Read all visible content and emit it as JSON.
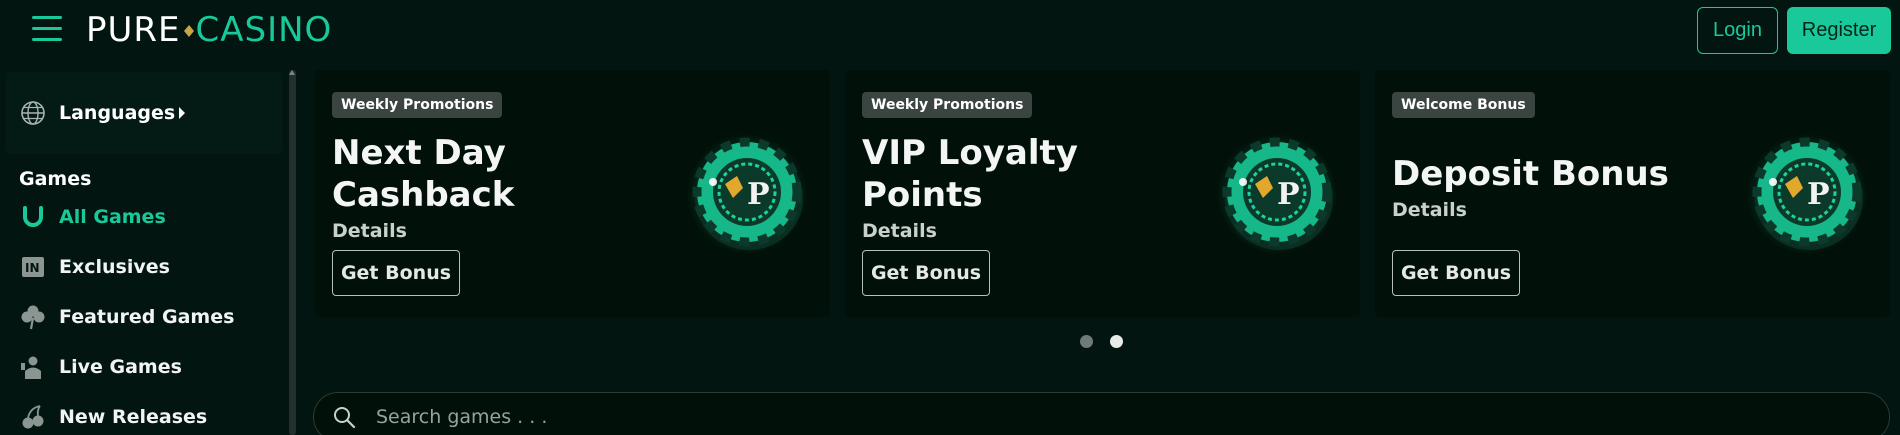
{
  "header": {
    "logo_left": "PURE",
    "logo_right": "CASINO",
    "login_label": "Login",
    "register_label": "Register"
  },
  "sidebar": {
    "languages_label": "Languages",
    "games_heading": "Games",
    "items": [
      {
        "label": "All Games",
        "icon": "horseshoe-icon",
        "active": true
      },
      {
        "label": "Exclusives",
        "icon": "exclusive-badge-icon",
        "active": false
      },
      {
        "label": "Featured Games",
        "icon": "clover-icon",
        "active": false
      },
      {
        "label": "Live Games",
        "icon": "live-dealer-icon",
        "active": false
      },
      {
        "label": "New Releases",
        "icon": "cherries-icon",
        "active": false
      }
    ]
  },
  "promos": [
    {
      "badge": "Weekly Promotions",
      "title_line1": "Next Day",
      "title_line2": "Cashback",
      "details": "Details",
      "button": "Get Bonus"
    },
    {
      "badge": "Weekly Promotions",
      "title_line1": "VIP Loyalty",
      "title_line2": "Points",
      "details": "Details",
      "button": "Get Bonus"
    },
    {
      "badge": "Welcome Bonus",
      "title_line1": "Deposit Bonus",
      "title_line2": "",
      "details": "Details",
      "button": "Get Bonus"
    }
  ],
  "carousel": {
    "active_index": 1,
    "count": 2
  },
  "search": {
    "placeholder": "Search games . . ."
  },
  "colors": {
    "background": "#021510",
    "accent": "#19c99a",
    "card": "#011109",
    "badge": "#3a4541"
  }
}
